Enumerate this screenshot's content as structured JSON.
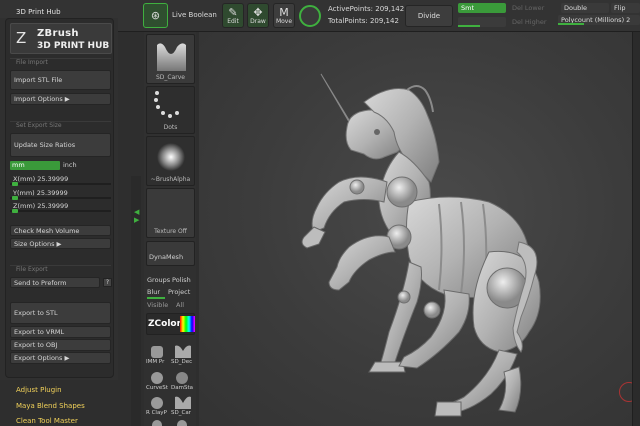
{
  "topbar": {
    "title": "3D Print Hub",
    "live_boolean_label": "Live Boolean",
    "edit_label": "Edit",
    "draw_label": "Draw",
    "move_label": "Move",
    "active_points": "ActivePoints: 209,142",
    "total_points": "TotalPoints: 209,142",
    "divide_label": "Divide",
    "smt_label": "Smt",
    "del_lower_label": "Del Lower",
    "del_higher_label": "Del Higher",
    "double_label": "Double",
    "flip_label": "Flip",
    "polycount_label": "Polycount (Millions) 2"
  },
  "logo": {
    "line1": "ZBrush",
    "line2": "3D PRINT HUB"
  },
  "left_panel": {
    "file_import_header": "File Import",
    "import_stl": "Import STL File",
    "import_options": "Import Options ▶",
    "set_export_size_header": "Set Export Size",
    "update_size_ratios": "Update Size Ratios",
    "unit_mm": "mm",
    "unit_inch": "inch",
    "x_mm": "X(mm) 25.39999",
    "y_mm": "Y(mm) 25.39999",
    "z_mm": "Z(mm) 25.39999",
    "check_mesh_volume": "Check Mesh Volume",
    "size_options": "Size Options ▶",
    "file_export_header": "File Export",
    "send_to_preform": "Send to Preform",
    "help_q": "?",
    "export_stl": "Export to STL",
    "export_vrml": "Export to VRML",
    "export_obj": "Export to OBJ",
    "export_options": "Export Options ▶"
  },
  "plugins": {
    "adjust_plugin": "Adjust Plugin",
    "maya_blend_shapes": "Maya Blend Shapes",
    "clean_tool_master": "Clean Tool Master"
  },
  "tool_column": {
    "sd_carve": "SD_Carve",
    "dots": "Dots",
    "brush_alpha": "~BrushAlpha",
    "texture_off": "Texture Off",
    "dynamesh": "DynaMesh",
    "groups": "Groups",
    "polish": "Polish",
    "blur": "Blur",
    "project": "Project",
    "visible": "Visible",
    "all": "All",
    "zcolor": "ZColor",
    "imm_pr": "IMM Pr",
    "sd_dec": "SD_Dec",
    "curve_st": "CurveSt",
    "dam_sta": "DamSta",
    "r_clay": "R ClayP",
    "sd_car": "SD_Car"
  },
  "colors": {
    "accent_green": "#3fb03f",
    "plugin_yellow": "#f2d25a",
    "model_gray": "#b9b9b9"
  }
}
